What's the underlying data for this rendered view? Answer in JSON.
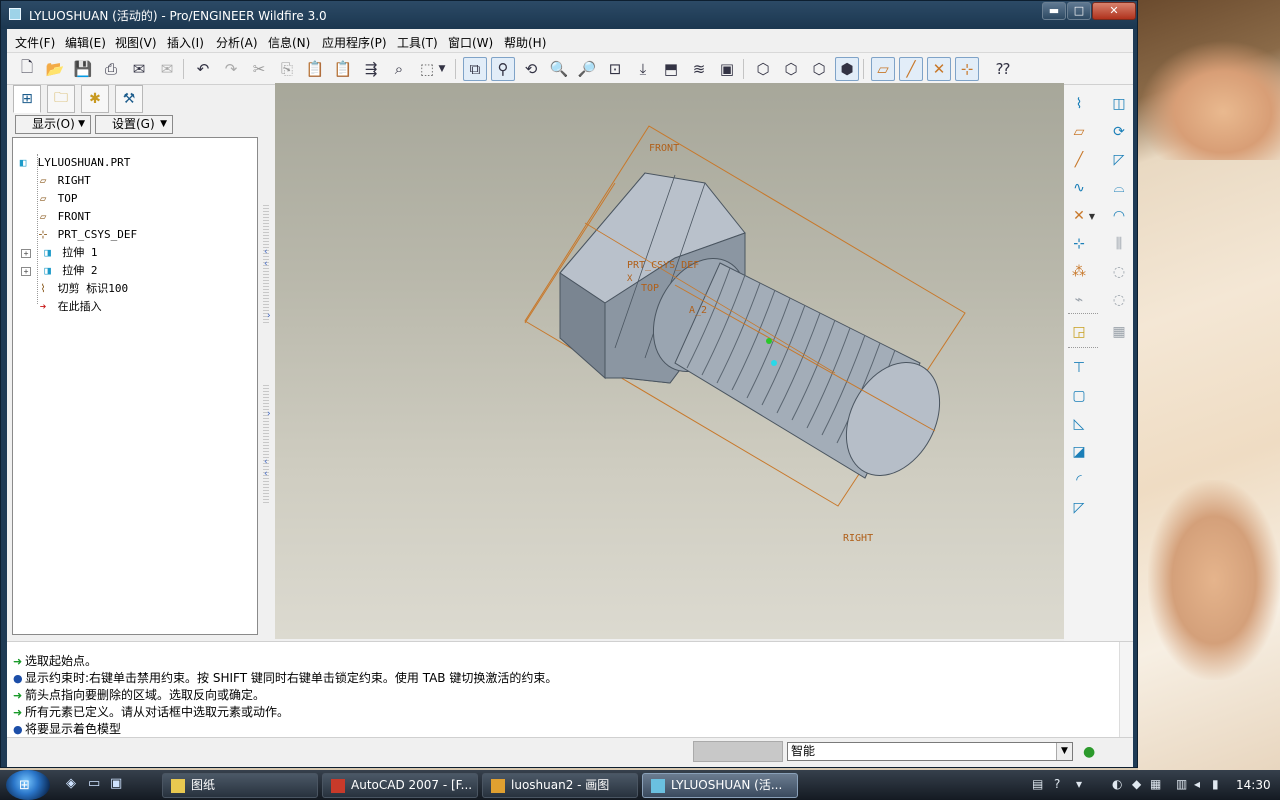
{
  "window": {
    "title": "LYLUOSHUAN (活动的) - Pro/ENGINEER Wildfire 3.0",
    "min_glyph": "▬",
    "max_glyph": "□",
    "close_glyph": "✕"
  },
  "menu": [
    "文件(F)",
    "编辑(E)",
    "视图(V)",
    "插入(I)",
    "分析(A)",
    "信息(N)",
    "应用程序(P)",
    "工具(T)",
    "窗口(W)",
    "帮助(H)"
  ],
  "tree": {
    "show_label": "显示(O)",
    "settings_label": "设置(G)",
    "items": [
      {
        "label": "LYLUOSHUAN.PRT",
        "icon": "part-icon",
        "glyph": "◧"
      },
      {
        "label": "RIGHT",
        "icon": "datum-plane-icon",
        "glyph": "▱"
      },
      {
        "label": "TOP",
        "icon": "datum-plane-icon",
        "glyph": "▱"
      },
      {
        "label": "FRONT",
        "icon": "datum-plane-icon",
        "glyph": "▱"
      },
      {
        "label": "PRT_CSYS_DEF",
        "icon": "csys-icon",
        "glyph": "⊹"
      },
      {
        "label": "拉伸 1",
        "icon": "extrude-icon",
        "glyph": "◨",
        "expander": "+"
      },
      {
        "label": "拉伸 2",
        "icon": "extrude-icon",
        "glyph": "◨",
        "expander": "+"
      },
      {
        "label": "切剪 标识100",
        "icon": "cut-icon",
        "glyph": "⌇"
      },
      {
        "label": "在此插入",
        "icon": "insert-here-icon",
        "glyph": "➔"
      }
    ]
  },
  "model_labels": {
    "front": "FRONT",
    "right": "RIGHT",
    "csys": "PRT_CSYS_DEF",
    "top": "TOP",
    "axis": "A_2",
    "csys_axis": "X"
  },
  "messages": [
    {
      "bullet": "arrow",
      "text": "选取起始点。"
    },
    {
      "bullet": "dot",
      "text": "显示约束时:右键单击禁用约束。按 SHIFT 键同时右键单击锁定约束。使用 TAB 键切换激活的约束。"
    },
    {
      "bullet": "arrow",
      "text": "箭头点指向要删除的区域。选取反向或确定。"
    },
    {
      "bullet": "arrow",
      "text": "所有元素已定义。请从对话框中选取元素或动作。"
    },
    {
      "bullet": "dot",
      "text": "将要显示着色模型"
    }
  ],
  "status": {
    "filter": "智能"
  },
  "taskbar": {
    "tasks": [
      {
        "label": "图纸",
        "icon": "folder-icon",
        "active": false
      },
      {
        "label": "AutoCAD 2007 - [F...",
        "icon": "autocad-icon",
        "active": false
      },
      {
        "label": "luoshuan2 - 画图",
        "icon": "paint-icon",
        "active": false
      },
      {
        "label": "LYLUOSHUAN (活...",
        "icon": "proe-icon",
        "active": true
      }
    ],
    "clock": "14:30"
  },
  "colors": {
    "titlebar": "#1b3750",
    "graphics_bg": "#c0bfb3",
    "datum": "#c8782a",
    "model": "#8c9aaa",
    "accent": "#1b7fb8"
  }
}
